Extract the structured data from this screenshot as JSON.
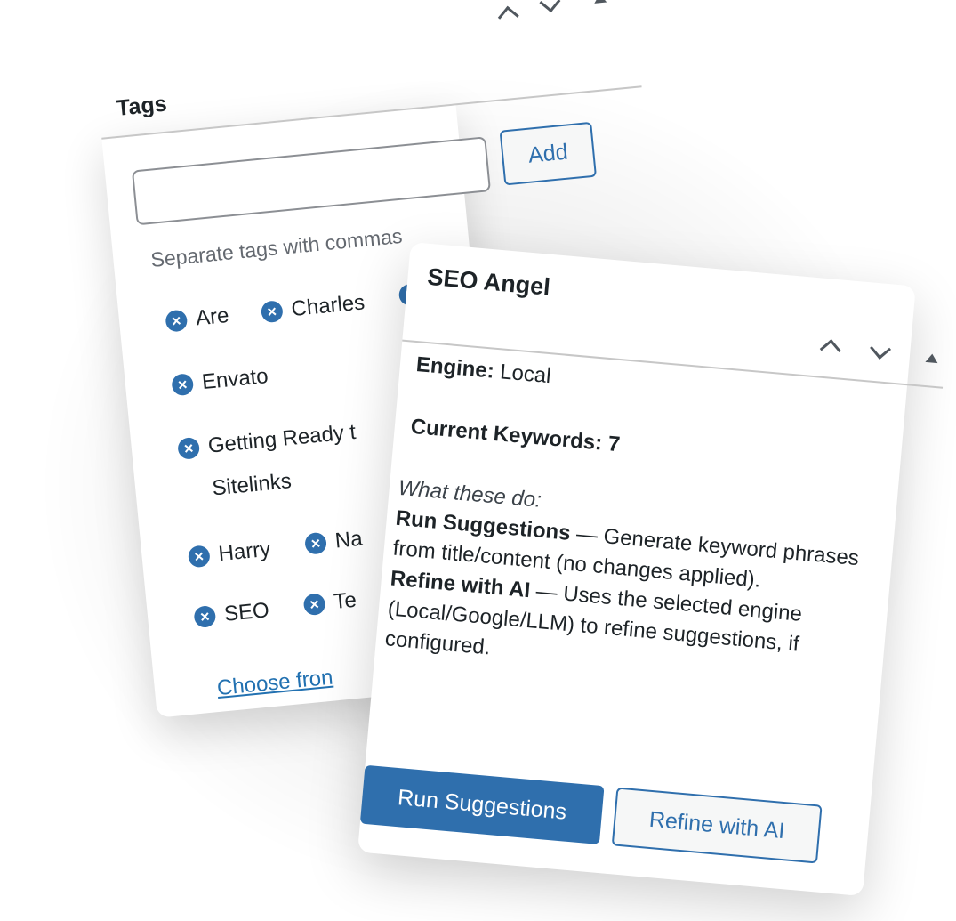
{
  "tags_panel": {
    "title": "Tags",
    "add_label": "Add",
    "input_value": "",
    "hint": "Separate tags with commas",
    "tags": [
      "Are",
      "Charles",
      "Envato",
      "Getting Ready t",
      "Sitelinks",
      "Harry",
      "Na",
      "SEO",
      "Te"
    ],
    "choose_link": "Choose fron"
  },
  "seo_panel": {
    "title": "SEO Angel",
    "engine_label": "Engine:",
    "engine_value": "Local",
    "keywords_label": "Current Keywords: 7",
    "what_label": "What these do:",
    "run_term": "Run Suggestions",
    "run_desc": " — Generate keyword phrases from title/content (no changes applied).",
    "refine_term": "Refine with AI",
    "refine_desc": " — Uses the selected engine (Local/Google/LLM) to refine suggestions, if configured.",
    "run_button": "Run Suggestions",
    "refine_button": "Refine with AI"
  },
  "colors": {
    "accent": "#2f6fad",
    "link": "#2271b1"
  }
}
